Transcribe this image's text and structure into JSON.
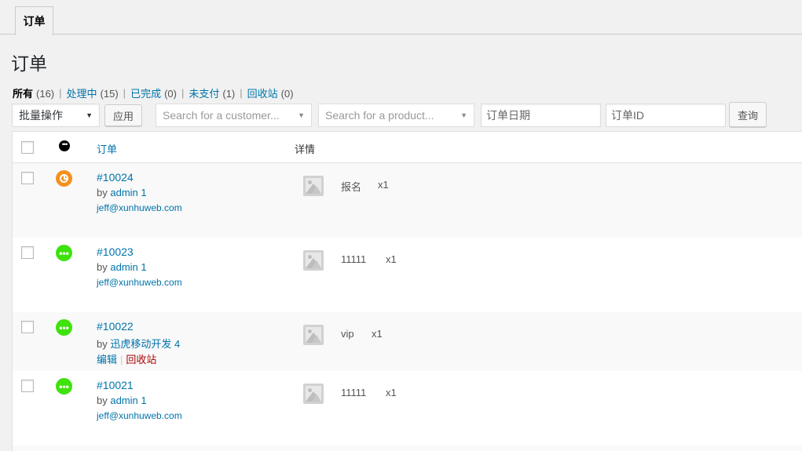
{
  "tabs": [
    {
      "label": "订单",
      "active": true
    }
  ],
  "page_title": "订单",
  "filters": [
    {
      "label": "所有",
      "count": "(16)",
      "current": true
    },
    {
      "label": "处理中",
      "count": "(15)",
      "current": false
    },
    {
      "label": "已完成",
      "count": "(0)",
      "current": false
    },
    {
      "label": "未支付",
      "count": "(1)",
      "current": false
    },
    {
      "label": "回收站",
      "count": "(0)",
      "current": false
    }
  ],
  "filter_separator": "|",
  "controls": {
    "bulk_action_label": "批量操作",
    "apply_label": "应用",
    "customer_search_placeholder": "Search for a customer...",
    "product_search_placeholder": "Search for a product...",
    "date_placeholder": "订单日期",
    "order_id_placeholder": "订单ID",
    "query_label": "查询"
  },
  "table": {
    "headers": {
      "order": "订单",
      "details": "详情"
    },
    "rows": [
      {
        "order_id": "#10024",
        "by_prefix": "by",
        "by_user": "admin 1",
        "email": "jeff@xunhuweb.com",
        "status": "pending",
        "item": "报名",
        "qty": "x1",
        "show_actions": false
      },
      {
        "order_id": "#10023",
        "by_prefix": "by",
        "by_user": "admin 1",
        "email": "jeff@xunhuweb.com",
        "status": "processing",
        "item": "11111",
        "qty": "x1",
        "show_actions": false
      },
      {
        "order_id": "#10022",
        "by_prefix": "by",
        "by_user": "迅虎移动开发 4",
        "email": "",
        "status": "processing",
        "item": "vip",
        "qty": "x1",
        "show_actions": true,
        "actions": {
          "edit": "编辑",
          "trash": "回收站"
        }
      },
      {
        "order_id": "#10021",
        "by_prefix": "by",
        "by_user": "admin 1",
        "email": "jeff@xunhuweb.com",
        "status": "processing",
        "item": "11111",
        "qty": "x1",
        "show_actions": false
      }
    ]
  },
  "icons": {
    "pending": "clock-icon",
    "processing": "ellipsis-icon",
    "thumbnail": "image-placeholder-icon"
  },
  "colors": {
    "pending": "#f5901d",
    "processing": "#3fe20d",
    "link": "#0073aa",
    "trash": "#aa0000"
  }
}
